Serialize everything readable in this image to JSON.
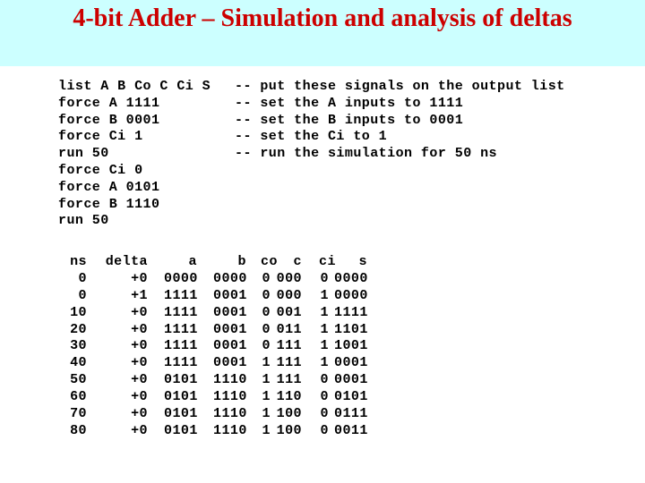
{
  "slide": {
    "title": "4-bit Adder – Simulation and analysis of deltas",
    "title_band_color": "#ccffff",
    "title_text_color": "#cc0000",
    "body_background": "#ffffff",
    "body_text_color": "#000000"
  },
  "commands": [
    {
      "text": "list A B Co C Ci S",
      "comment": "-- put these signals on the output list"
    },
    {
      "text": "force A 1111",
      "comment": "-- set the A inputs to 1111"
    },
    {
      "text": "force B 0001",
      "comment": "-- set the B inputs to 0001"
    },
    {
      "text": "force Ci 1",
      "comment": "-- set the Ci to 1"
    },
    {
      "text": "run 50",
      "comment": "-- run the simulation for 50 ns"
    },
    {
      "text": "force Ci 0",
      "comment": ""
    },
    {
      "text": "force A 0101",
      "comment": ""
    },
    {
      "text": "force B 1110",
      "comment": ""
    },
    {
      "text": "run 50",
      "comment": ""
    }
  ],
  "results": {
    "headers": {
      "ns": "ns",
      "delta": "delta",
      "a": "a",
      "b": "b",
      "co": "co",
      "c": "c",
      "ci": "ci",
      "s": "s"
    },
    "rows": [
      {
        "ns": "0",
        "delta": "+0",
        "a": "0000",
        "b": "0000",
        "co": "0",
        "c": "000",
        "ci": "0",
        "s": "0000"
      },
      {
        "ns": "0",
        "delta": "+1",
        "a": "1111",
        "b": "0001",
        "co": "0",
        "c": "000",
        "ci": "1",
        "s": "0000"
      },
      {
        "ns": "10",
        "delta": "+0",
        "a": "1111",
        "b": "0001",
        "co": "0",
        "c": "001",
        "ci": "1",
        "s": "1111"
      },
      {
        "ns": "20",
        "delta": "+0",
        "a": "1111",
        "b": "0001",
        "co": "0",
        "c": "011",
        "ci": "1",
        "s": "1101"
      },
      {
        "ns": "30",
        "delta": "+0",
        "a": "1111",
        "b": "0001",
        "co": "0",
        "c": "111",
        "ci": "1",
        "s": "1001"
      },
      {
        "ns": "40",
        "delta": "+0",
        "a": "1111",
        "b": "0001",
        "co": "1",
        "c": "111",
        "ci": "1",
        "s": "0001"
      },
      {
        "ns": "50",
        "delta": "+0",
        "a": "0101",
        "b": "1110",
        "co": "1",
        "c": "111",
        "ci": "0",
        "s": "0001"
      },
      {
        "ns": "60",
        "delta": "+0",
        "a": "0101",
        "b": "1110",
        "co": "1",
        "c": "110",
        "ci": "0",
        "s": "0101"
      },
      {
        "ns": "70",
        "delta": "+0",
        "a": "0101",
        "b": "1110",
        "co": "1",
        "c": "100",
        "ci": "0",
        "s": "0111"
      },
      {
        "ns": "80",
        "delta": "+0",
        "a": "0101",
        "b": "1110",
        "co": "1",
        "c": "100",
        "ci": "0",
        "s": "0011"
      }
    ]
  }
}
